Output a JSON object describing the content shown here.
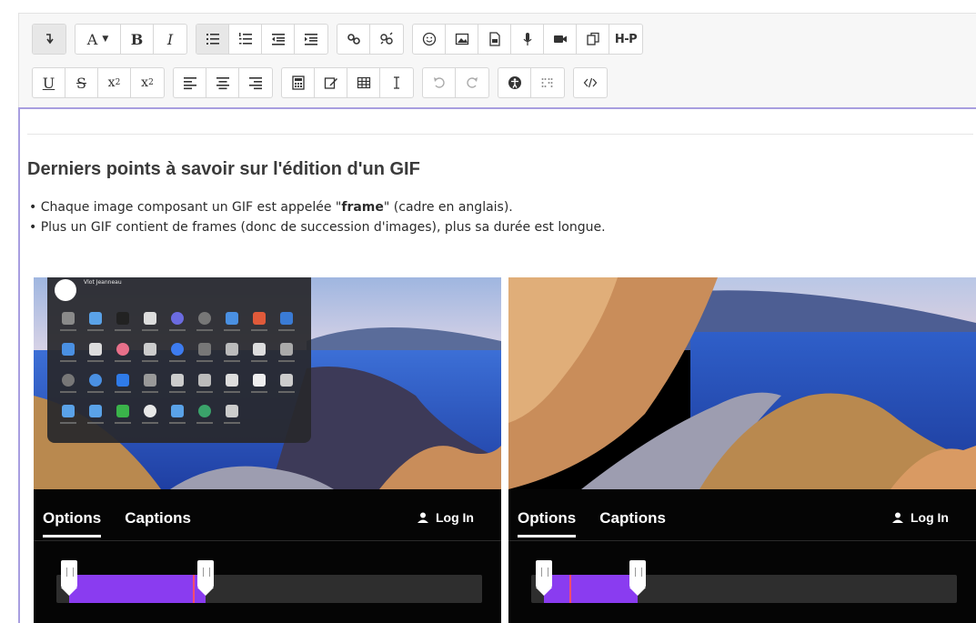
{
  "toolbar": {
    "h5p_label": "H-P",
    "row1": {
      "font_label": "A",
      "bold_label": "B",
      "italic_label": "I"
    },
    "row2": {
      "underline_label": "U",
      "strike_label": "S",
      "subscript_label": "x",
      "subscript_sub": "2",
      "superscript_label": "x",
      "superscript_sup": "2"
    }
  },
  "editor": {
    "title": "Derniers points à savoir sur l'édition d'un GIF",
    "bullets": [
      {
        "before": "Chaque image composant un GIF est appelée \"",
        "bold": "frame",
        "after": "\" (cadre en anglais)."
      },
      {
        "before": "Plus un GIF contient de frames (donc de succession d'images), plus sa durée est longue.",
        "bold": "",
        "after": ""
      }
    ]
  },
  "frames": [
    {
      "tabs": [
        {
          "label": "Options",
          "active": true
        },
        {
          "label": "Captions",
          "active": false
        }
      ],
      "login_label": "Log In",
      "selection_start": 0.03,
      "selection_end": 0.35,
      "playhead": 0.32,
      "has_launcher_overlay": true
    },
    {
      "tabs": [
        {
          "label": "Options",
          "active": true
        },
        {
          "label": "Captions",
          "active": false
        }
      ],
      "login_label": "Log In",
      "selection_start": 0.03,
      "selection_end": 0.25,
      "playhead": 0.09,
      "has_launcher_overlay": false
    }
  ],
  "colors": {
    "selection": "#8a3cf0",
    "playhead": "#ff4d6d",
    "editor_border": "#a89ee0",
    "sea": "#2f5fc9",
    "cliff": "#c98d5a"
  },
  "launcher": {
    "user_name": "Vlot Jeanneau"
  }
}
